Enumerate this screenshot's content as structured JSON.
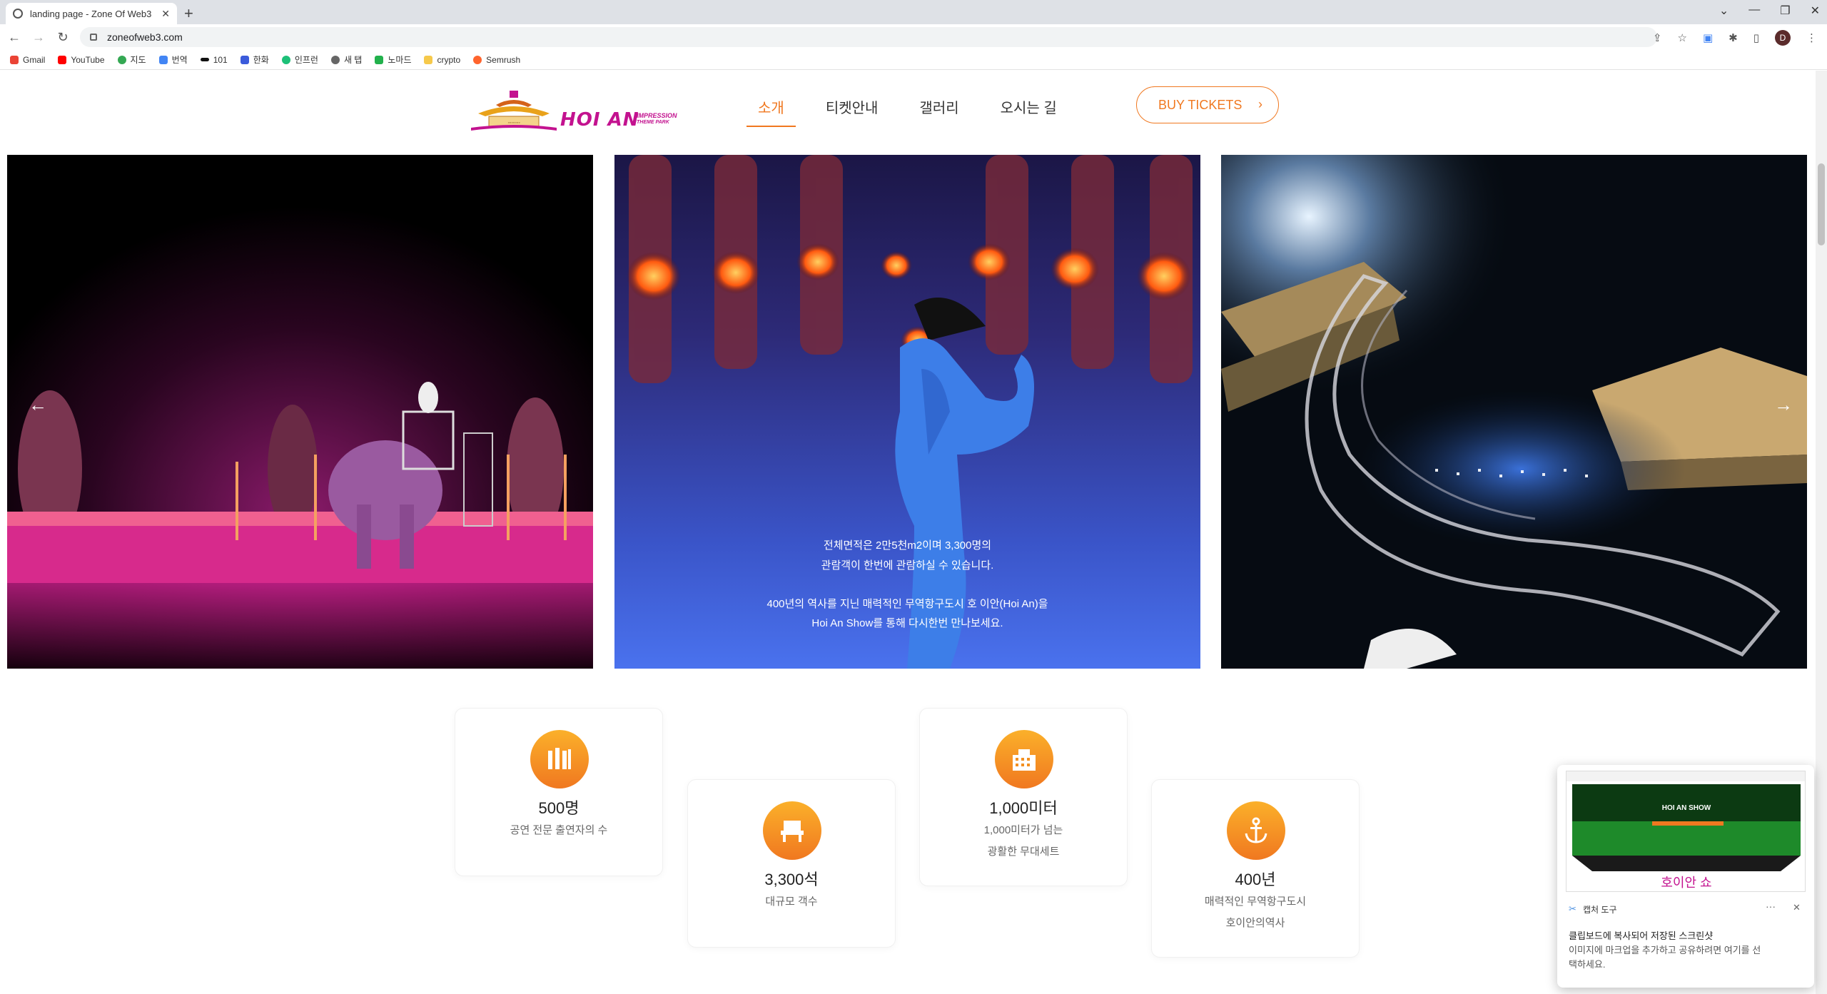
{
  "browser": {
    "tab_title": "landing page - Zone Of Web3",
    "url": "zoneofweb3.com",
    "avatar_letter": "D",
    "bookmarks": [
      "Gmail",
      "YouTube",
      "지도",
      "번역",
      "101",
      "한화",
      "인프런",
      "새 탭",
      "노마드",
      "crypto",
      "Semrush"
    ]
  },
  "header": {
    "logo_text": "HOI AN",
    "logo_sub_1": "IMPRESSION",
    "logo_sub_2": "THEME PARK",
    "nav": [
      "소개",
      "티켓안내",
      "갤러리",
      "오시는 길"
    ],
    "buy_label": "BUY TICKETS"
  },
  "slider": {
    "middle_text_1": "전체면적은 2만5천m2이며 3,300명의",
    "middle_text_2": "관람객이 한번에 관람하실 수 있습니다.",
    "middle_text_3": "400년의 역사를 지닌 매력적인 무역항구도시 호 이안(Hoi An)을",
    "middle_text_4": "Hoi An Show를 통해 다시한번 만나보세요."
  },
  "features": [
    {
      "num": "500명",
      "desc_1": "공연 전문 출연자의 수",
      "desc_2": "",
      "icon": "performer-icon"
    },
    {
      "num": "3,300석",
      "desc_1": "대규모 객수",
      "desc_2": "",
      "icon": "seat-icon"
    },
    {
      "num": "1,000미터",
      "desc_1": "1,000미터가 넘는",
      "desc_2": "광활한 무대세트",
      "icon": "building-icon"
    },
    {
      "num": "400년",
      "desc_1": "매력적인 무역항구도시",
      "desc_2": "호이안의역사",
      "icon": "anchor-icon"
    }
  ],
  "toast": {
    "app_name": "캡처 도구",
    "thumb_title": "HOI AN SHOW",
    "thumb_caption": "호이안 쇼",
    "line_1": "클립보드에 복사되어 저장된 스크린샷",
    "line_2": "이미지에 마크업을 추가하고 공유하려면 여기를 선",
    "line_3": "택하세요."
  },
  "colors": {
    "accent": "#f07820",
    "brand_pink": "#c3128f"
  }
}
